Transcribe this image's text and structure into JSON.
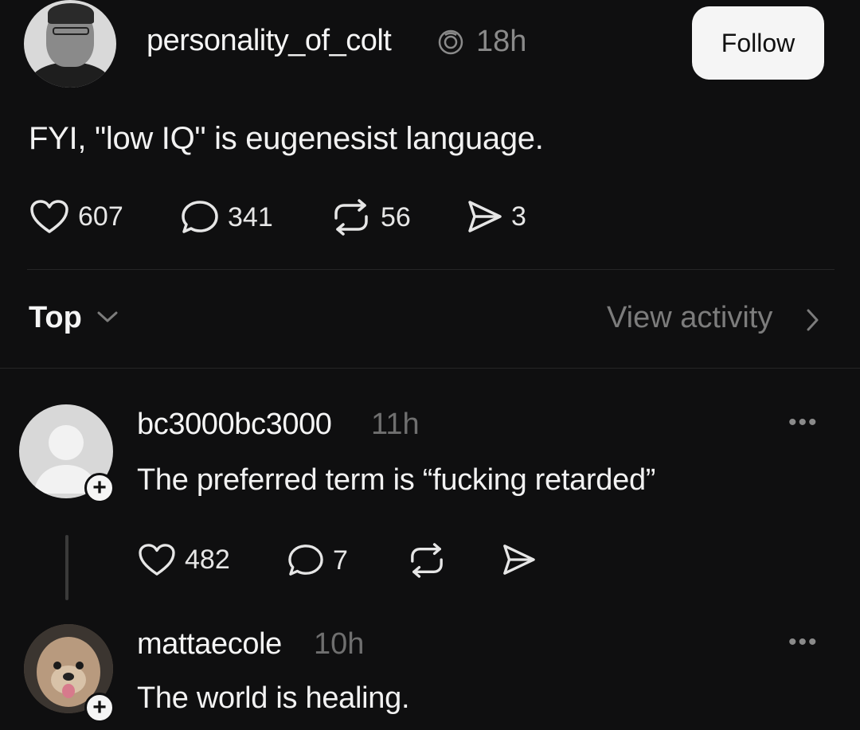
{
  "post": {
    "username": "personality_of_colt",
    "time": "18h",
    "follow_label": "Follow",
    "text": "FYI, \"low IQ\" is eugenesist language.",
    "likes": "607",
    "replies": "341",
    "reposts": "56",
    "shares": "3"
  },
  "replies_header": {
    "sort_label": "Top",
    "view_activity": "View activity"
  },
  "replies": [
    {
      "username": "bc3000bc3000",
      "time": "11h",
      "text": "The preferred term is “fucking retarded”",
      "likes": "482",
      "replies": "7"
    },
    {
      "username": "mattaecole",
      "time": "10h",
      "text": "The world is healing."
    }
  ],
  "icons": {
    "verified": "threads-verified-icon",
    "like": "heart-icon",
    "comment": "comment-icon",
    "repost": "repost-icon",
    "share": "share-icon",
    "more": "more-icon",
    "plus": "plus"
  },
  "colors": {
    "background": "#0f0f10",
    "text": "#f3f3f3",
    "muted": "#7a7a7a",
    "button": "#f5f5f5"
  }
}
